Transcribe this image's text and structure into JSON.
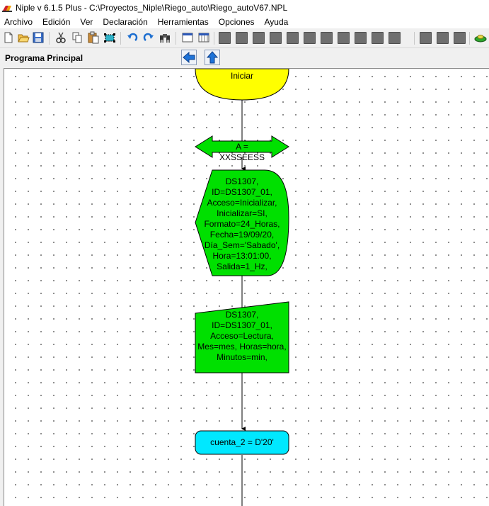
{
  "window": {
    "title": "Niple v 6.1.5  Plus - C:\\Proyectos_Niple\\Riego_auto\\Riego_autoV67.NPL"
  },
  "menu": [
    "Archivo",
    "Edición",
    "Ver",
    "Declaración",
    "Herramientas",
    "Opciones",
    "Ayuda"
  ],
  "toolbar": {
    "icons": [
      "new-file-icon",
      "open-folder-icon",
      "save-icon",
      "cut-icon",
      "copy-icon",
      "paste-icon",
      "select-icon",
      "undo-icon",
      "redo-icon",
      "binoculars-icon",
      "window-icon",
      "grid-icon"
    ]
  },
  "panel": {
    "title": "Programa Principal"
  },
  "flow": {
    "start": "Iniciar",
    "io": "A = XXSSEESS",
    "config_lines": [
      "DS1307,",
      "ID=DS1307_01,",
      "Acceso=Inicializar,",
      "Inicializar=SI,",
      "Formato=24_Horas,",
      "Fecha=19/09/20,",
      "Día_Sem='Sabado',",
      "Hora=13:01:00,",
      "Salida=1_Hz,"
    ],
    "read_lines": [
      "DS1307,",
      "ID=DS1307_01,",
      "Acceso=Lectura,",
      "Mes=mes, Horas=hora,",
      "Minutos=min,"
    ],
    "assign": "cuenta_2 = D'20'"
  },
  "colors": {
    "start_fill": "#ffff00",
    "block_fill": "#00e000",
    "assign_fill": "#00e8ff",
    "arrow_blue": "#1e73d8"
  }
}
